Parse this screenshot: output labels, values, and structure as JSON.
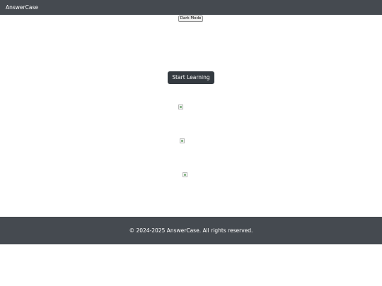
{
  "header": {
    "brand": "AnswerCase"
  },
  "toolbar": {
    "dark_mode_label": "Dark Mode"
  },
  "hero": {
    "cta_label": "Start Learning"
  },
  "images": [
    {
      "icon": "broken-image-icon"
    },
    {
      "icon": "broken-image-icon"
    },
    {
      "icon": "broken-image-icon"
    }
  ],
  "footer": {
    "copyright": "© 2024-2025 AnswerCase. All rights reserved."
  },
  "colors": {
    "bar_background": "#454a50",
    "button_background": "#343a40",
    "page_background": "#ffffff"
  }
}
